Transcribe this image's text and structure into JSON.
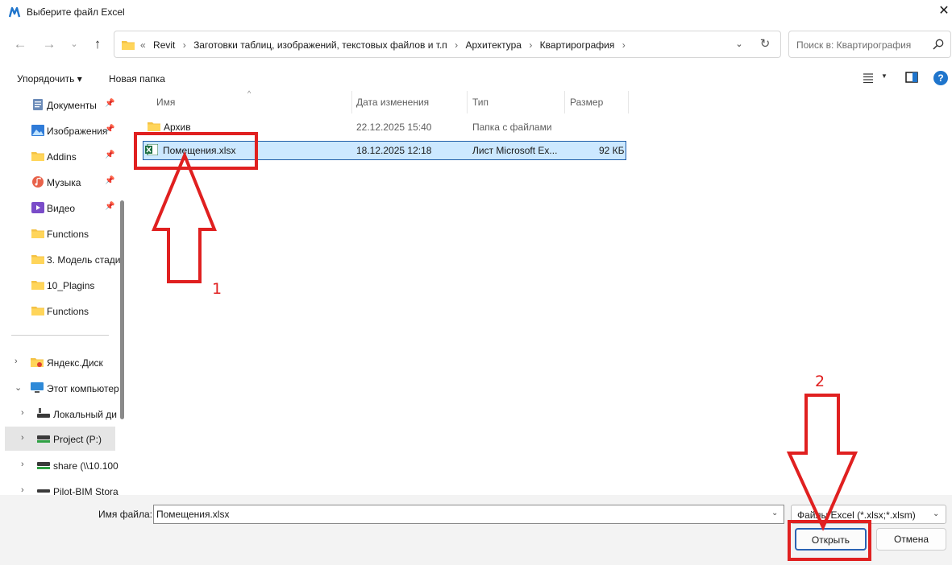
{
  "window": {
    "title": "Выберите файл Excel",
    "close_glyph": "✕",
    "accent_color": "#1f75cc"
  },
  "navigation": {
    "back_glyph": "←",
    "forward_glyph": "→",
    "recent_glyph": "⌄",
    "up_glyph": "↑"
  },
  "address": {
    "prefix": "«",
    "crumbs": [
      "Revit",
      "Заготовки таблиц, изображений, текстовых файлов и т.п",
      "Архитектура",
      "Квартирография"
    ],
    "separator": "›",
    "dropdown_glyph": "⌄",
    "refresh_glyph": "↻"
  },
  "search": {
    "placeholder": "Поиск в: Квартирография"
  },
  "toolbar": {
    "sort_label": "Упорядочить ▾",
    "new_folder_label": "Новая папка",
    "view_dropdown_glyph": "▼",
    "help_glyph": "?"
  },
  "sidebar": {
    "quick_items": [
      {
        "label": "Документы",
        "icon": "documents-icon",
        "pinned": true
      },
      {
        "label": "Изображения",
        "icon": "pictures-icon",
        "pinned": true
      },
      {
        "label": "Addins",
        "icon": "folder-icon",
        "pinned": true
      },
      {
        "label": "Музыка",
        "icon": "music-icon",
        "pinned": true
      },
      {
        "label": "Видео",
        "icon": "video-icon",
        "pinned": true
      },
      {
        "label": "Functions",
        "icon": "folder-icon",
        "pinned": false
      },
      {
        "label": "3. Модель стади",
        "icon": "folder-icon",
        "pinned": false
      },
      {
        "label": "10_Plagins",
        "icon": "folder-icon",
        "pinned": false
      },
      {
        "label": "Functions",
        "icon": "folder-icon",
        "pinned": false
      }
    ],
    "tree_items": [
      {
        "label": "Яндекс.Диск",
        "icon": "folder-icon",
        "expander": "›"
      },
      {
        "label": "Этот компьютер",
        "icon": "computer-icon",
        "expander": "⌄"
      },
      {
        "label": "Локальный ди",
        "icon": "drive-icon",
        "expander": "›"
      },
      {
        "label": "Project (P:)",
        "icon": "network-drive-icon",
        "expander": "›",
        "selected": true
      },
      {
        "label": "share (\\\\10.100",
        "icon": "network-drive-icon",
        "expander": "›"
      },
      {
        "label": "Pilot-BIM Stora",
        "icon": "network-drive-icon",
        "expander": "›"
      }
    ],
    "pin_glyph": "📌"
  },
  "files": {
    "columns": [
      "Имя",
      "Дата изменения",
      "Тип",
      "Размер"
    ],
    "sort_glyph": "^",
    "rows": [
      {
        "name": "Архив",
        "date": "22.12.2025 15:40",
        "type": "Папка с файлами",
        "size": "",
        "icon": "folder-icon",
        "selected": false
      },
      {
        "name": "Помещения.xlsx",
        "date": "18.12.2025 12:18",
        "type": "Лист Microsoft Ex...",
        "size": "92 КБ",
        "icon": "excel-file-icon",
        "selected": true
      }
    ]
  },
  "footer": {
    "filename_label": "Имя файла:",
    "filename_value": "Помещения.xlsx",
    "filetype_value": "Файлы Excel (*.xlsx;*.xlsm)",
    "dropdown_glyph": "⌄",
    "open_label": "Открыть",
    "cancel_label": "Отмена"
  },
  "annotations": {
    "color": "#e02020",
    "step1": "1",
    "step2": "2"
  }
}
